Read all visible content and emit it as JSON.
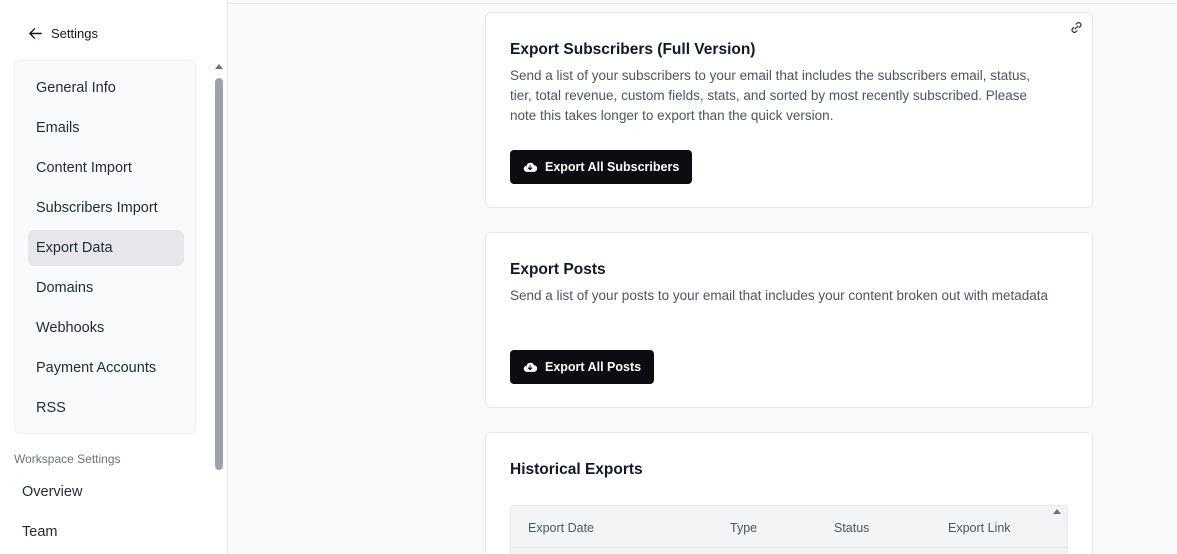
{
  "sidebar": {
    "back_label": "Settings",
    "items": [
      {
        "label": "General Info"
      },
      {
        "label": "Emails"
      },
      {
        "label": "Content Import"
      },
      {
        "label": "Subscribers Import"
      },
      {
        "label": "Export Data",
        "active": true
      },
      {
        "label": "Domains"
      },
      {
        "label": "Webhooks"
      },
      {
        "label": "Payment Accounts"
      },
      {
        "label": "RSS"
      }
    ],
    "workspace_heading": "Workspace Settings",
    "workspace_items": [
      {
        "label": "Overview"
      },
      {
        "label": "Team"
      }
    ]
  },
  "cards": {
    "subscribers": {
      "title": "Export Subscribers (Full Version)",
      "description": "Send a list of your subscribers to your email that includes the subscribers email, status, tier, total revenue, custom fields, stats, and sorted by most recently subscribed. Please note this takes longer to export than the quick version.",
      "button_label": "Export All Subscribers"
    },
    "posts": {
      "title": "Export Posts",
      "description": "Send a list of your posts to your email that includes your content broken out with metadata",
      "button_label": "Export All Posts"
    },
    "history": {
      "title": "Historical Exports",
      "columns": [
        "Export Date",
        "Type",
        "Status",
        "Export Link"
      ]
    }
  },
  "icons": {
    "back": "arrow-left-icon",
    "link": "link-icon",
    "export": "cloud-download-icon"
  },
  "colors": {
    "button_bg": "#0b0d12",
    "active_nav_bg": "#e5e7eb"
  }
}
